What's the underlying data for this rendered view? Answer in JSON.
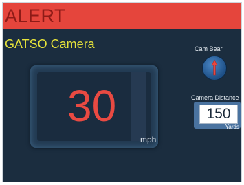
{
  "alert": {
    "text": "ALERT"
  },
  "camera": {
    "title": "GATSO Camera"
  },
  "speed": {
    "value": "30",
    "unit": "mph"
  },
  "bearing": {
    "label": "Cam Beari",
    "icon": "up-arrow-icon"
  },
  "distance": {
    "label": "Camera Distance",
    "value": "150",
    "unit": "Yards"
  },
  "colors": {
    "alert_bar": "#e5453c",
    "alert_text": "#8e1b17",
    "title": "#e6e33a",
    "speed_value": "#e94a42",
    "background": "#1b2d3f"
  }
}
